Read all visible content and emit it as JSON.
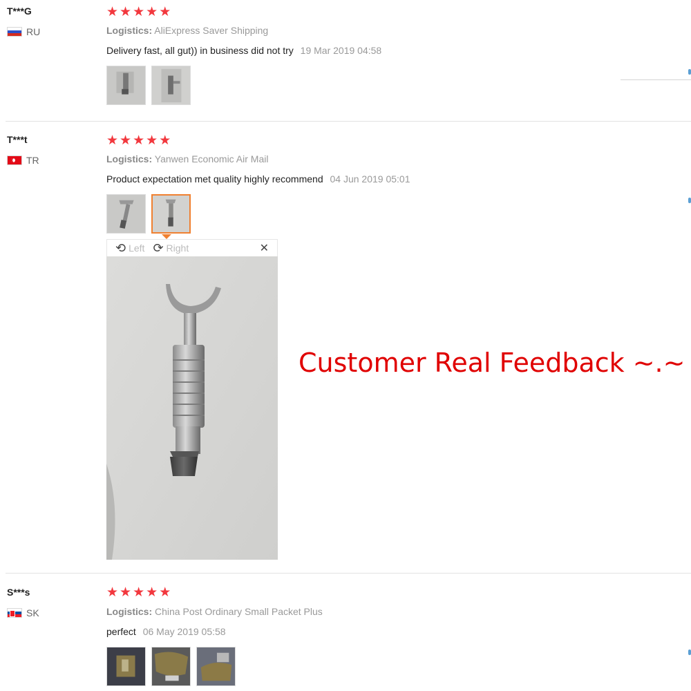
{
  "reviews": [
    {
      "user": "T***G",
      "country_code": "RU",
      "rating": 5,
      "logistics_label": "Logistics:",
      "logistics_value": "AliExpress Saver Shipping",
      "comment": "Delivery fast, all gut)) in business did not try",
      "date": "19 Mar 2019 04:58",
      "thumbnail_count": 2
    },
    {
      "user": "T***t",
      "country_code": "TR",
      "rating": 5,
      "logistics_label": "Logistics:",
      "logistics_value": "Yanwen Economic Air Mail",
      "comment": "Product expectation met quality highly recommend",
      "date": "04 Jun 2019 05:01",
      "thumbnail_count": 2,
      "selected_thumbnail": 2
    },
    {
      "user": "S***s",
      "country_code": "SK",
      "rating": 5,
      "logistics_label": "Logistics:",
      "logistics_value": "China Post Ordinary Small Packet Plus",
      "comment": "perfect",
      "date": "06 May 2019 05:58",
      "thumbnail_count": 3
    }
  ],
  "viewer": {
    "rotate_left_label": "Left",
    "rotate_right_label": "Right",
    "rotate_left_icon": "rotate-left-icon",
    "rotate_right_icon": "rotate-right-icon",
    "close_icon": "close-icon",
    "close_glyph": "✕"
  },
  "overlay": {
    "text": "Customer Real Feedback ~.~",
    "color": "#e00000"
  },
  "colors": {
    "star": "#f2383e",
    "active_thumb_border": "#f08030"
  }
}
